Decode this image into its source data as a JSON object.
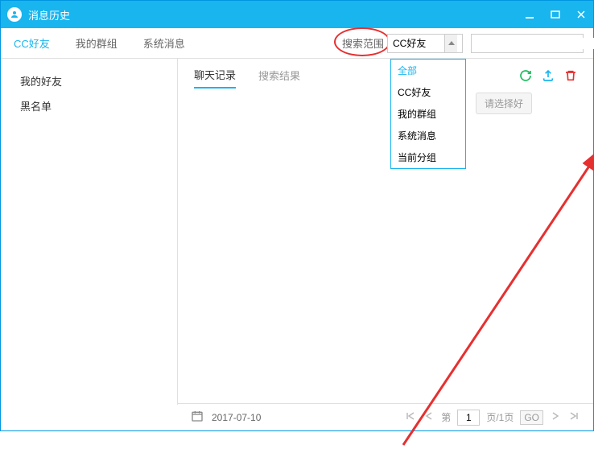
{
  "window": {
    "title": "消息历史"
  },
  "tabs": {
    "friends": "CC好友",
    "groups": "我的群组",
    "system": "系统消息"
  },
  "scope": {
    "label": "搜索范围",
    "selected": "CC好友",
    "options": [
      "全部",
      "CC好友",
      "我的群组",
      "系统消息",
      "当前分组"
    ]
  },
  "search": {
    "placeholder": ""
  },
  "sidebar": {
    "items": [
      "我的好友",
      "黑名单"
    ]
  },
  "content_tabs": {
    "chat": "聊天记录",
    "results": "搜索结果"
  },
  "hint": "请选择好",
  "footer": {
    "date": "2017-07-10",
    "page_label_prefix": "第",
    "page_value": "1",
    "page_label_suffix": "页/1页",
    "go": "GO"
  }
}
